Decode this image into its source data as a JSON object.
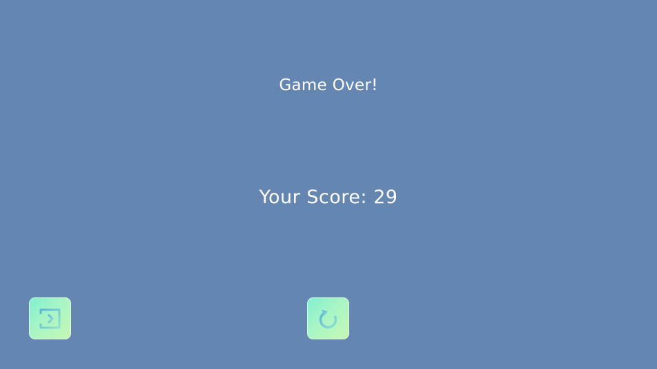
{
  "game_over": {
    "title": "Game Over!",
    "score_text": "Your Score: 29"
  },
  "buttons": {
    "exit": {
      "icon": "exit-icon"
    },
    "restart": {
      "icon": "restart-icon"
    }
  },
  "colors": {
    "background": "#6586b1",
    "text": "#ffffff",
    "button_gradient_start": "#7ff0d2",
    "button_gradient_end": "#c7f7b4",
    "icon_stroke": "#6cc6d6"
  }
}
